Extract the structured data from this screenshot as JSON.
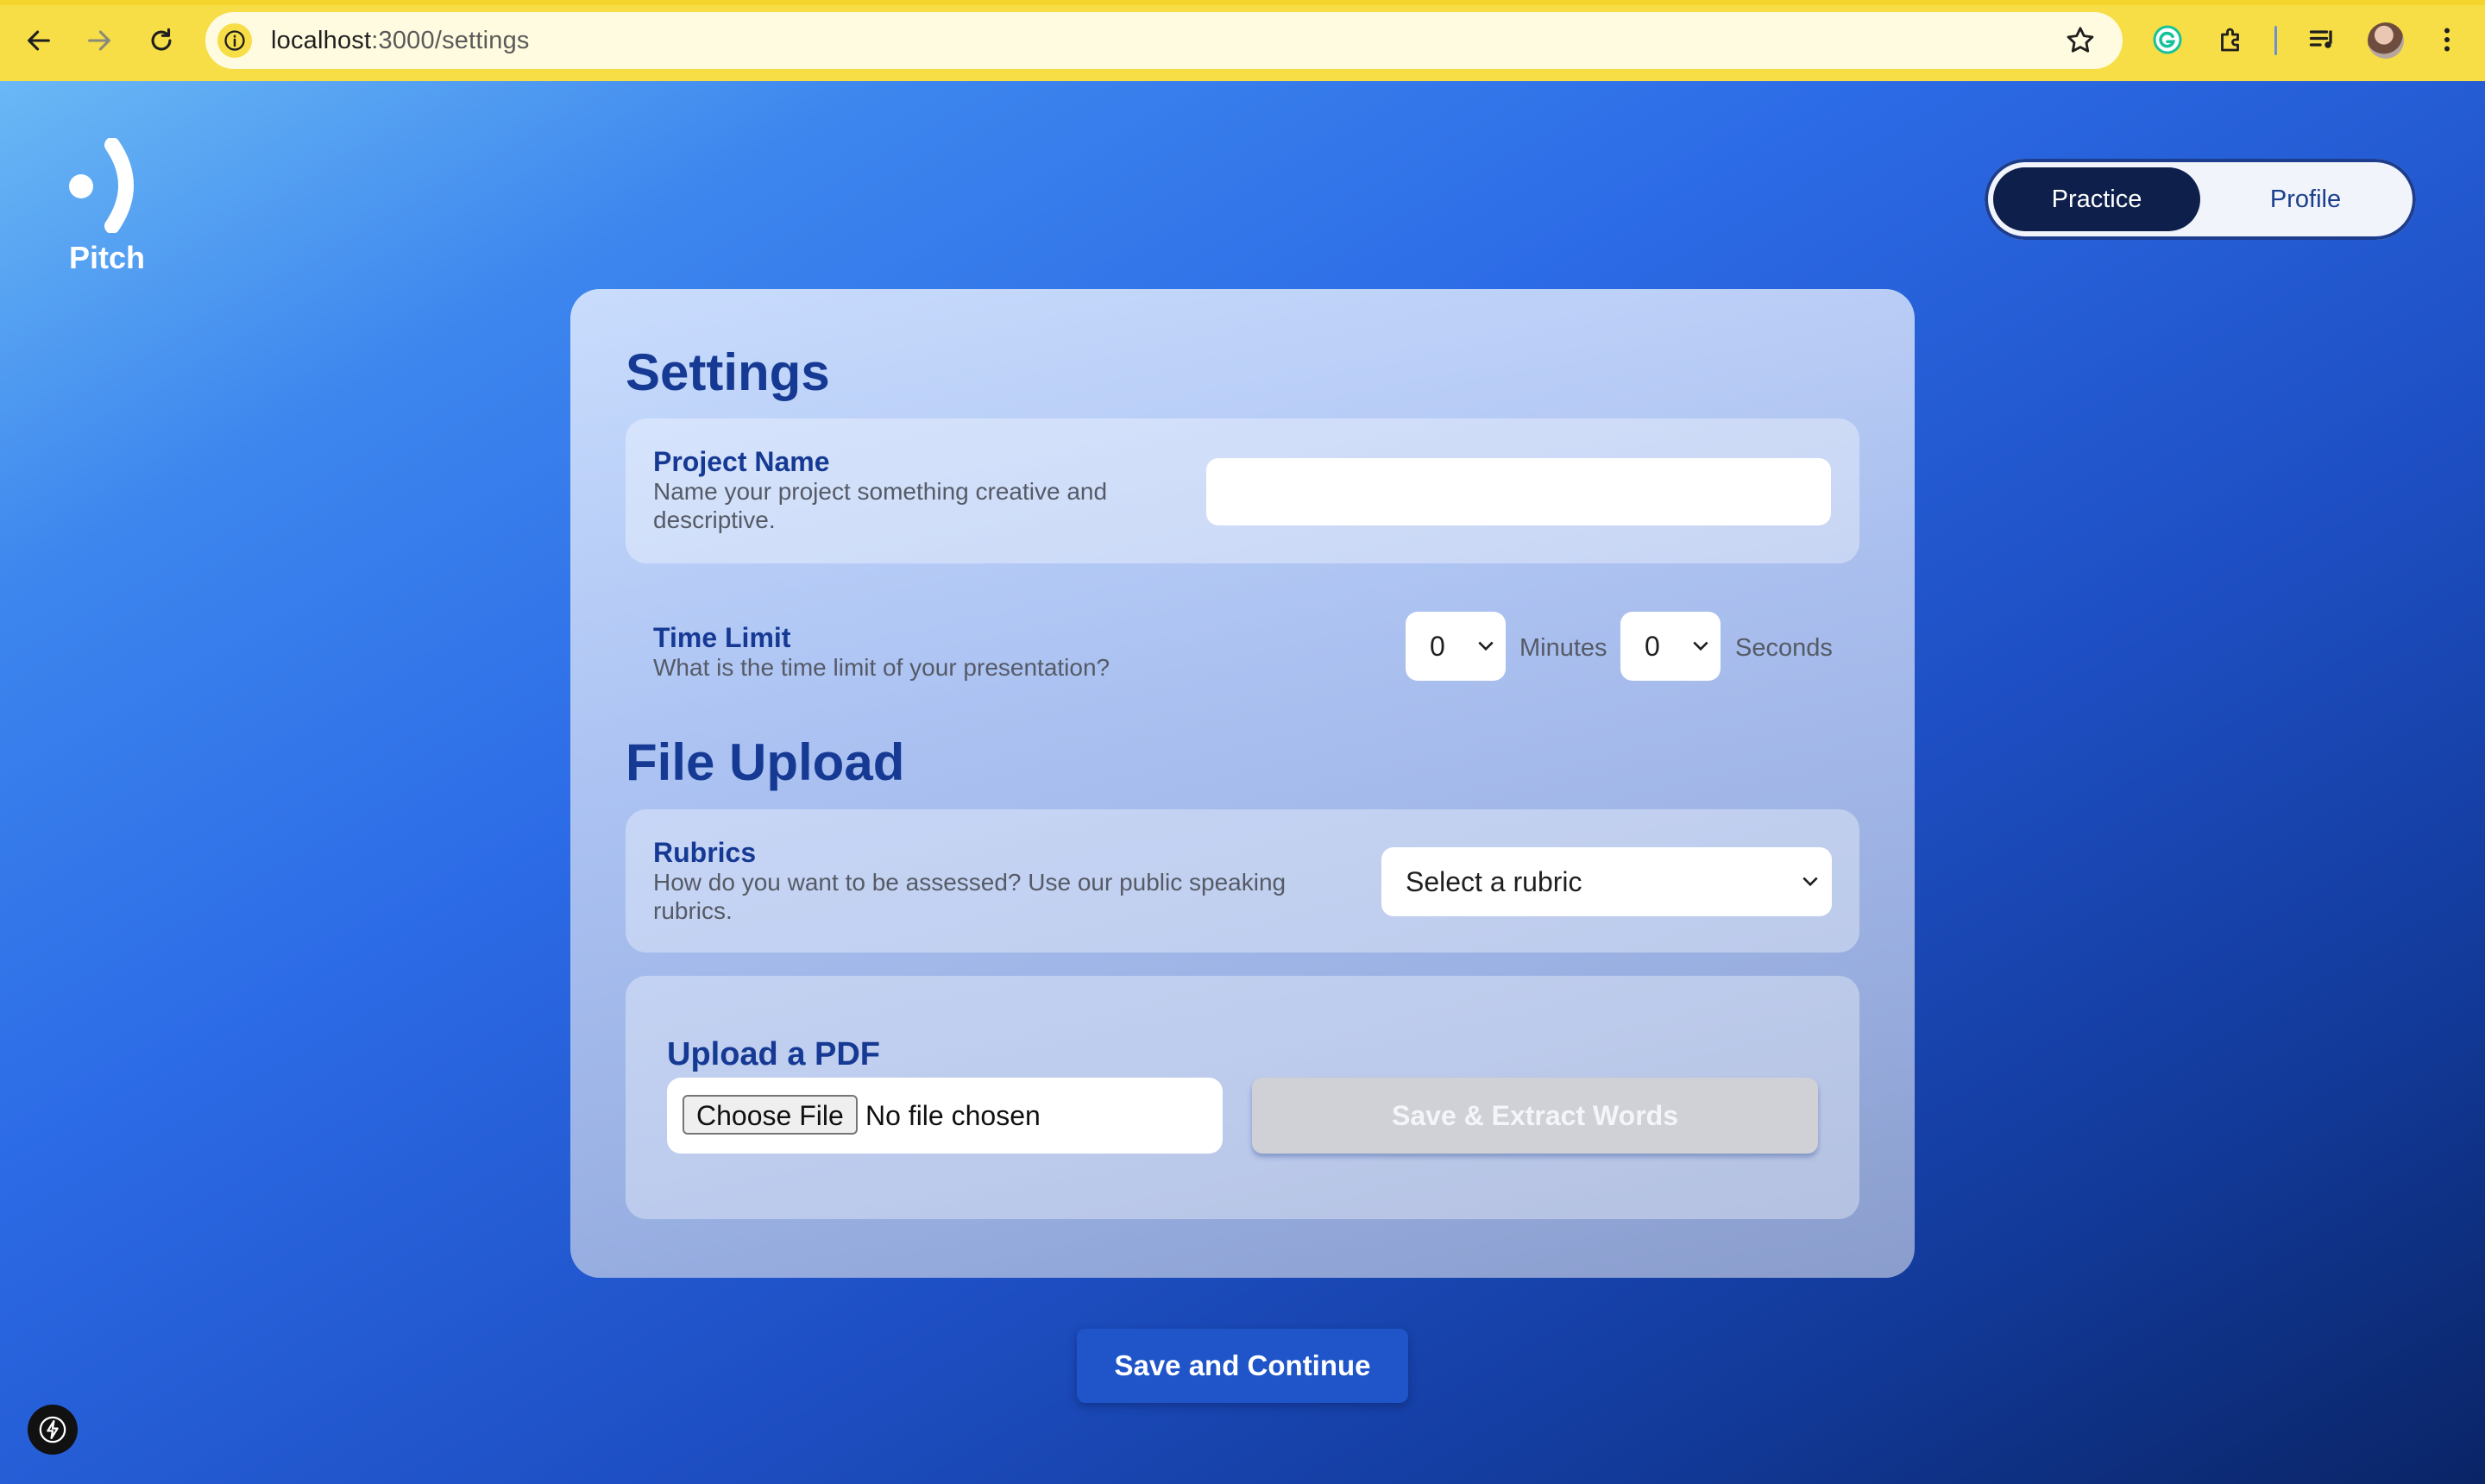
{
  "browser": {
    "url_host": "localhost",
    "url_path": ":3000/settings",
    "icons": [
      "back-arrow-icon",
      "forward-arrow-icon",
      "reload-icon",
      "site-info-icon",
      "bookmark-star-icon",
      "grammarly-extension-icon",
      "extensions-puzzle-icon",
      "media-controls-icon",
      "profile-avatar",
      "more-menu-icon"
    ]
  },
  "app": {
    "logo_text": "Pitch",
    "nav": {
      "practice": "Practice",
      "profile": "Profile",
      "active": "Practice"
    }
  },
  "settings": {
    "heading": "Settings",
    "project": {
      "title": "Project Name",
      "description": "Name your project something creative and descriptive.",
      "value": ""
    },
    "time_limit": {
      "title": "Time Limit",
      "description": "What is the time limit of your presentation?",
      "minutes_value": "0",
      "minutes_label": "Minutes",
      "seconds_value": "0",
      "seconds_label": "Seconds"
    }
  },
  "file_upload": {
    "heading": "File Upload",
    "rubrics": {
      "title": "Rubrics",
      "description": "How do you want to be assessed? Use our public speaking rubrics.",
      "selected": "Select a rubric"
    },
    "pdf": {
      "title": "Upload a PDF",
      "choose_label": "Choose File",
      "status": "No file chosen",
      "extract_label": "Save & Extract Words"
    }
  },
  "footer": {
    "save_label": "Save and Continue"
  },
  "colors": {
    "chrome_yellow": "#f7dd46",
    "accent_dark_navy": "#0d1f4a",
    "heading_blue": "#163a94",
    "primary_button": "#1f55c8"
  }
}
